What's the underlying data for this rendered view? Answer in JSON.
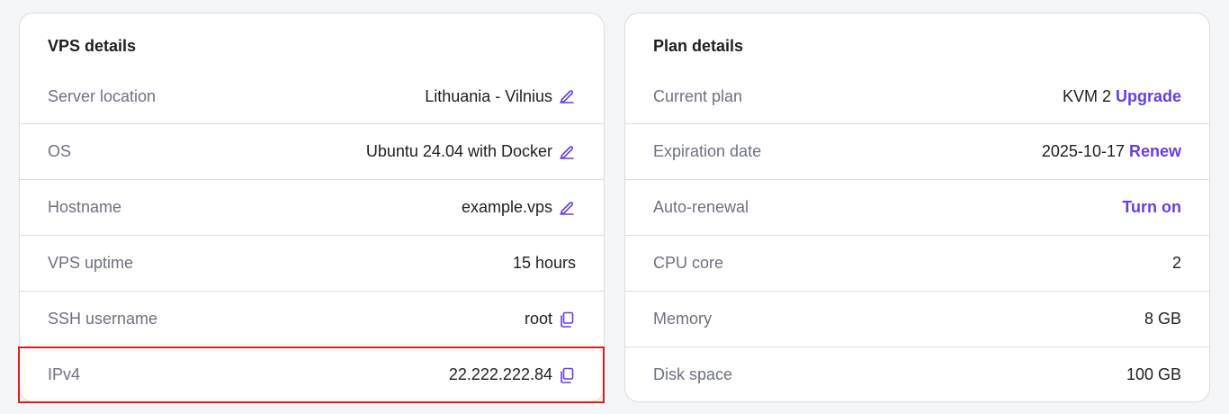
{
  "vps_details": {
    "title": "VPS details",
    "rows": [
      {
        "label": "Server location",
        "value": "Lithuania - Vilnius",
        "icon": "pencil-icon"
      },
      {
        "label": "OS",
        "value": "Ubuntu 24.04 with Docker",
        "icon": "pencil-icon"
      },
      {
        "label": "Hostname",
        "value": "example.vps",
        "icon": "pencil-icon"
      },
      {
        "label": "VPS uptime",
        "value": "15 hours"
      },
      {
        "label": "SSH username",
        "value": "root",
        "icon": "copy-icon"
      },
      {
        "label": "IPv4",
        "value": "22.222.222.84",
        "icon": "copy-icon"
      }
    ]
  },
  "plan_details": {
    "title": "Plan details",
    "rows": [
      {
        "label": "Current plan",
        "value": "KVM 2",
        "action": "Upgrade"
      },
      {
        "label": "Expiration date",
        "value": "2025-10-17",
        "action": "Renew"
      },
      {
        "label": "Auto-renewal",
        "action": "Turn on"
      },
      {
        "label": "CPU core",
        "value": "2"
      },
      {
        "label": "Memory",
        "value": "8 GB"
      },
      {
        "label": "Disk space",
        "value": "100 GB"
      }
    ]
  },
  "colors": {
    "accent": "#673de6",
    "highlight_border": "#e21b1b",
    "muted_text": "#6d7081",
    "divider": "#dadce0"
  }
}
